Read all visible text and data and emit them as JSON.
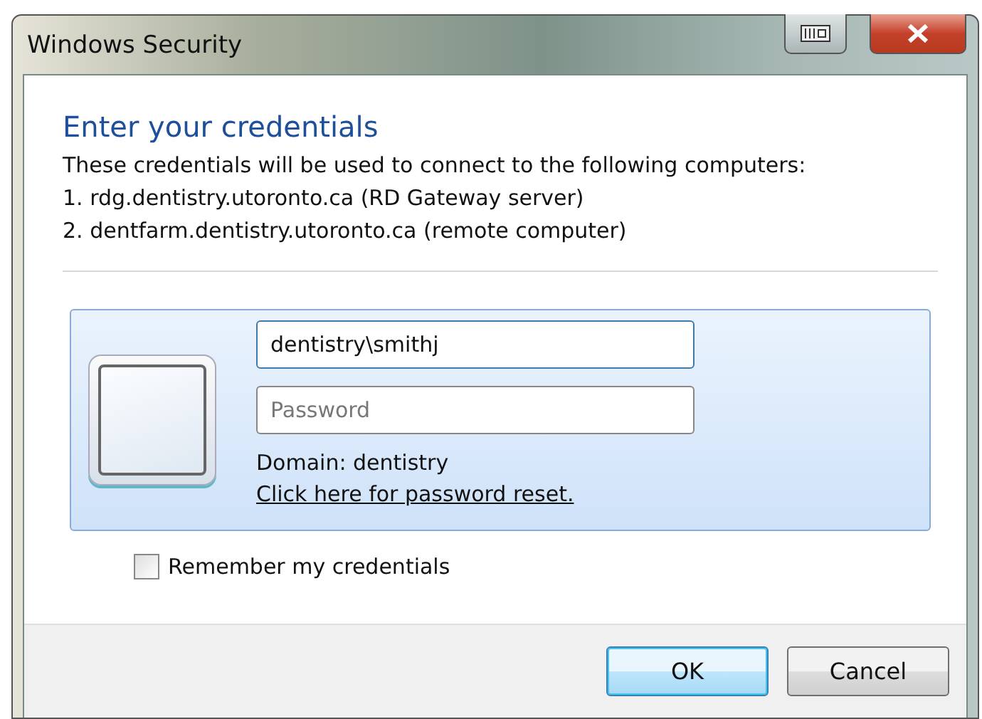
{
  "window": {
    "title": "Windows Security"
  },
  "heading": "Enter your credentials",
  "description": [
    "These credentials will be used to connect to the following computers:",
    "1. rdg.dentistry.utoronto.ca (RD Gateway server)",
    "2. dentfarm.dentistry.utoronto.ca (remote computer)"
  ],
  "credential": {
    "username": {
      "value": "dentistry\\smithj",
      "focused": true
    },
    "password": {
      "placeholder": "Password"
    },
    "domain": "Domain: dentistry",
    "reset_link": "Click here for password reset."
  },
  "remember": {
    "label": "Remember my credentials",
    "checked": false
  },
  "buttons": [
    {
      "label": "OK",
      "default": true
    },
    {
      "label": "Cancel",
      "default": false
    }
  ]
}
